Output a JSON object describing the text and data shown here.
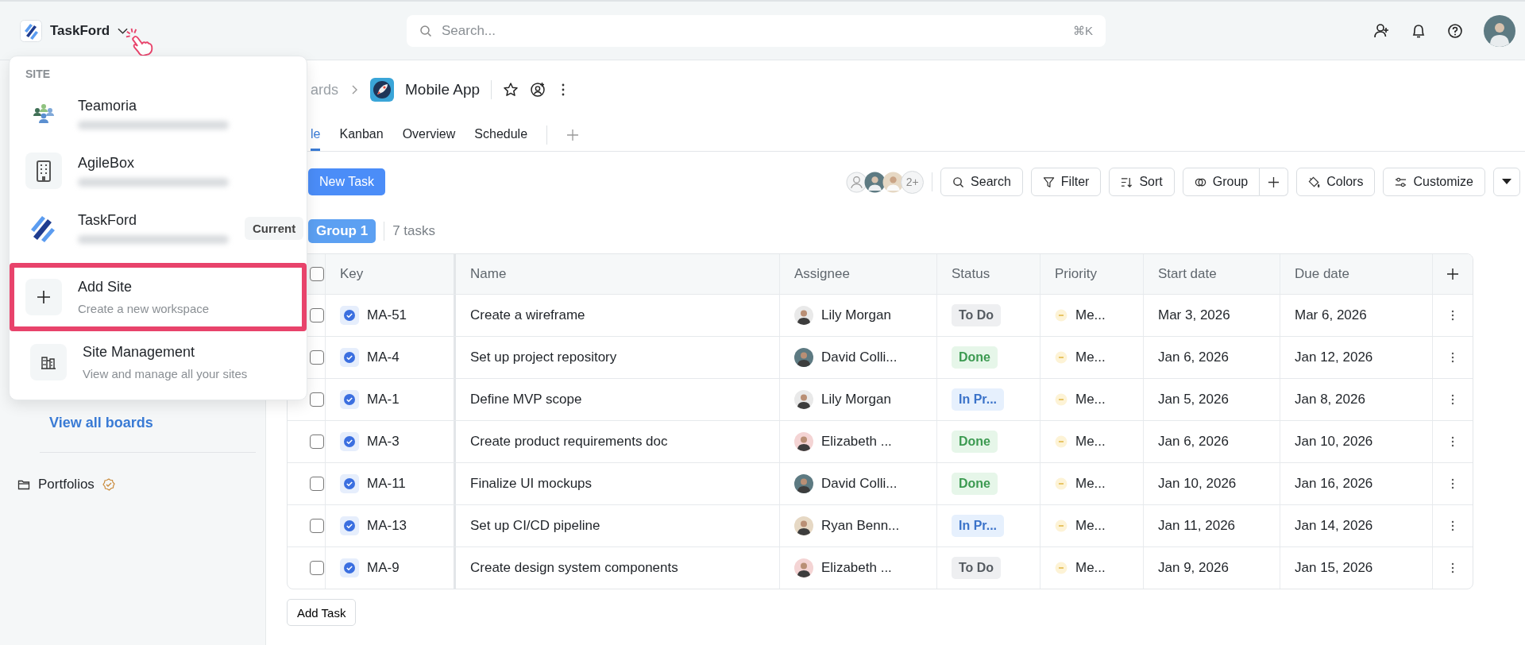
{
  "topbar": {
    "site_name": "TaskFord",
    "search": {
      "placeholder": "Search...",
      "shortcut": "⌘K"
    }
  },
  "site_menu": {
    "heading": "SITE",
    "sites": [
      {
        "name": "Teamoria",
        "kind": "people"
      },
      {
        "name": "AgileBox",
        "kind": "building"
      },
      {
        "name": "TaskFord",
        "kind": "logo",
        "badge": "Current"
      }
    ],
    "actions": [
      {
        "title": "Add Site",
        "subtitle": "Create a new workspace",
        "kind": "plus",
        "highlighted": true
      },
      {
        "title": "Site Management",
        "subtitle": "View and manage all your sites",
        "kind": "buildings",
        "highlighted": false
      }
    ]
  },
  "sidebar": {
    "view_all": "View all boards",
    "portfolios": "Portfolios"
  },
  "board": {
    "breadcrumb": "ards",
    "title": "Mobile App",
    "tabs": [
      {
        "label": "le",
        "selected": true
      },
      {
        "label": "Kanban",
        "selected": false
      },
      {
        "label": "Overview",
        "selected": false
      },
      {
        "label": "Schedule",
        "selected": false
      }
    ],
    "new_task": "New Task",
    "more_members": "2+",
    "tools": [
      {
        "label": "Search",
        "kind": "search"
      },
      {
        "label": "Filter",
        "kind": "filter"
      },
      {
        "label": "Sort",
        "kind": "sort"
      },
      {
        "label": "Group",
        "kind": "group"
      },
      {
        "label": "Colors",
        "kind": "colors"
      },
      {
        "label": "Customize",
        "kind": "customize"
      }
    ],
    "group": {
      "label": "Group 1",
      "count": "7 tasks"
    },
    "table": {
      "header_checked": false,
      "columns": [
        "Key",
        "Name",
        "Assignee",
        "Status",
        "Priority",
        "Start date",
        "Due date"
      ],
      "rows": [
        {
          "checked": false,
          "key": "MA-51",
          "name": "Create a wireframe",
          "assignee": "Lily Morgan",
          "status": {
            "label": "To Do",
            "kind": "todo"
          },
          "priority": "Me...",
          "start": "Mar 3, 2026",
          "due": "Mar 6, 2026"
        },
        {
          "checked": false,
          "key": "MA-4",
          "name": "Set up project repository",
          "assignee": "David Colli...",
          "status": {
            "label": "Done",
            "kind": "done"
          },
          "priority": "Me...",
          "start": "Jan 6, 2026",
          "due": "Jan 12, 2026"
        },
        {
          "checked": false,
          "key": "MA-1",
          "name": "Define MVP scope",
          "assignee": "Lily Morgan",
          "status": {
            "label": "In Pr...",
            "kind": "progress"
          },
          "priority": "Me...",
          "start": "Jan 5, 2026",
          "due": "Jan 8, 2026"
        },
        {
          "checked": false,
          "key": "MA-3",
          "name": "Create product requirements doc",
          "assignee": "Elizabeth ...",
          "status": {
            "label": "Done",
            "kind": "done"
          },
          "priority": "Me...",
          "start": "Jan 6, 2026",
          "due": "Jan 10, 2026"
        },
        {
          "checked": false,
          "key": "MA-11",
          "name": "Finalize UI mockups",
          "assignee": "David Colli...",
          "status": {
            "label": "Done",
            "kind": "done"
          },
          "priority": "Me...",
          "start": "Jan 10, 2026",
          "due": "Jan 16, 2026"
        },
        {
          "checked": false,
          "key": "MA-13",
          "name": "Set up CI/CD pipeline",
          "assignee": "Ryan Benn...",
          "status": {
            "label": "In Pr...",
            "kind": "progress"
          },
          "priority": "Me...",
          "start": "Jan 11, 2026",
          "due": "Jan 14, 2026"
        },
        {
          "checked": false,
          "key": "MA-9",
          "name": "Create design system components",
          "assignee": "Elizabeth ...",
          "status": {
            "label": "To Do",
            "kind": "todo"
          },
          "priority": "Me...",
          "start": "Jan 9, 2026",
          "due": "Jan 15, 2026"
        }
      ]
    },
    "add_task": "Add Task"
  }
}
